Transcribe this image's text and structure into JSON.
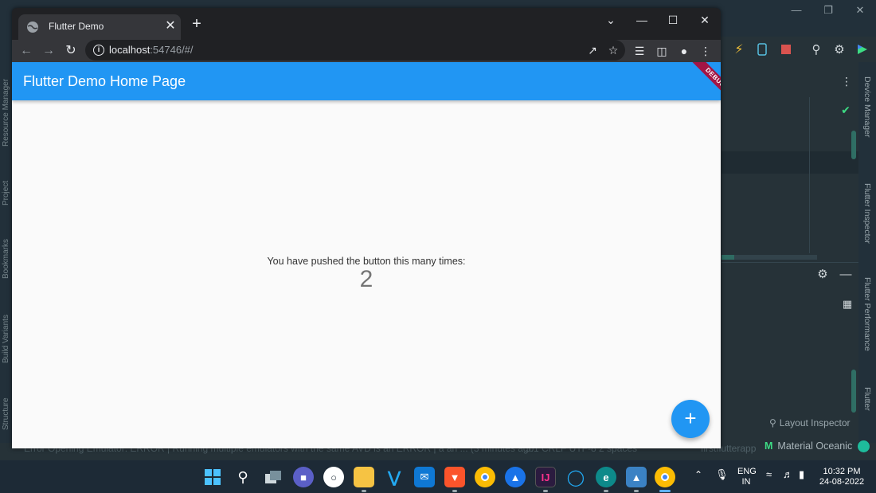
{
  "browser": {
    "tab_title": "Flutter Demo",
    "url_host": "localhost",
    "url_path": ":54746/#/"
  },
  "app": {
    "appbar_title": "Flutter Demo Home Page",
    "debug_banner": "DEBUG",
    "counter_label": "You have pushed the button this many times:",
    "counter_value": "2",
    "fab_label": "+"
  },
  "ide": {
    "left_tools": [
      "Resource Manager",
      "Project",
      "Bookmarks",
      "Build Variants",
      "Structure"
    ],
    "right_tools": [
      "Device Manager",
      "Flutter Inspector",
      "Flutter Performance",
      "Flutter"
    ],
    "layout_inspector": "Layout Inspector",
    "theme": "Material Oceanic",
    "status_faint_left": "Error Opening Emulator: ERROR  | Running multiple emulators with the same AVD is an ERROR  | a an ... (3 minutes ago",
    "status_faint_right": "5:1  CRLF  UTF-8  2 spaces",
    "project_name": "firstflutterapp"
  },
  "taskbar": {
    "language": "ENG",
    "region": "IN",
    "time": "10:32 PM",
    "date": "24-08-2022"
  },
  "colors": {
    "flutter_primary": "#2196f3",
    "debug_banner": "#a31545",
    "ide_background": "#263238",
    "taskbar": "#1d2a36"
  }
}
